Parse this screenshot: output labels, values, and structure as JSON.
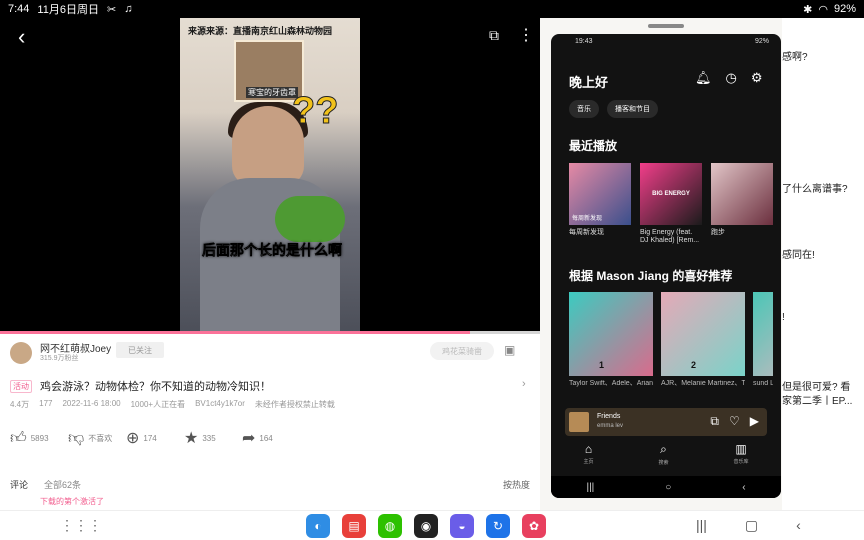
{
  "statusbar": {
    "time": "7:44",
    "date": "11月6日周日",
    "battery": "92%"
  },
  "video": {
    "top_caption": "来源来源：直播南京红山森林动物园",
    "inset_label": "寒宝的牙齿罩",
    "subtitle": "后面那个长的是什么啊",
    "progress": 0.87
  },
  "uploader": {
    "name": "网不红萌叔Joey",
    "fans": "315.9万粉丝",
    "followed": "已关注"
  },
  "search_placeholder": "鸡花菜骑凿",
  "video_info": {
    "tag": "活动",
    "title": "鸡会游泳？动物体检？你不知道的动物冷知识！",
    "views": "4.4万",
    "danmaku": "177",
    "published": "2022-11-6 18:00",
    "watching": "1000+人正在看",
    "bvid": "BV1ct4y1k7or",
    "notice": "未经作者授权禁止转载"
  },
  "actions": [
    {
      "icon": "thumb-up-icon",
      "label": "5893"
    },
    {
      "icon": "thumb-down-icon",
      "label": "不喜欢"
    },
    {
      "icon": "coin-icon",
      "label": "174"
    },
    {
      "icon": "star-icon",
      "label": "335"
    },
    {
      "icon": "share-icon",
      "label": "164"
    }
  ],
  "comments": {
    "label": "评论",
    "count": "全部62条",
    "sort": "按热度"
  },
  "comment_peek": "下载的第个激活了",
  "bg_text": [
    "感啊?",
    "了什么离谱事?",
    "感同在!",
    "!",
    "但是很可爱? 看",
    "家第二季丨EP..."
  ],
  "phone": {
    "status_time": "19:43",
    "battery": "92%",
    "greeting": "晚上好",
    "chips": [
      "音乐",
      "播客和节目"
    ],
    "recent_title": "最近播放",
    "recent": [
      {
        "caption": "每周新发现",
        "art_text": "每周新发现",
        "color1": "#e68aa5",
        "color2": "#3a4f8c"
      },
      {
        "caption": "Big Energy (feat. DJ Khaled) [Rem...",
        "art_text": "BIG ENERGY",
        "color1": "#f23e8a",
        "color2": "#1b1b1b"
      },
      {
        "caption": "跑步",
        "art_text": "",
        "color1": "#e2c6c8",
        "color2": "#6b2f3e"
      }
    ],
    "recs_title": "根据 Mason Jiang 的喜好推荐",
    "recs": [
      {
        "num": "1",
        "caption": "Taylor Swift、Adele、Ariana Grande 等更多曲目",
        "color1": "#3ccbc0",
        "color2": "#d96b8c"
      },
      {
        "num": "2",
        "caption": "AJR、Melanie Martinez、The Score 等更多曲目",
        "color1": "#e5a9b7",
        "color2": "#7ad3c9"
      },
      {
        "num": "",
        "caption": "sund Lund",
        "color1": "#4bc6b6",
        "color2": "#e5b6c2"
      }
    ],
    "now_playing": {
      "title": "Friends",
      "artist": "emma lev"
    },
    "nav": [
      "主页",
      "搜索",
      "音乐库"
    ]
  },
  "dock": [
    {
      "name": "browser-app",
      "color": "#2f8de4",
      "glyph": "◐"
    },
    {
      "name": "notes-app",
      "color": "#e8403a",
      "glyph": "▤"
    },
    {
      "name": "wechat-app",
      "color": "#2dc100",
      "glyph": "◍"
    },
    {
      "name": "qq-app",
      "color": "#222222",
      "glyph": "◉"
    },
    {
      "name": "internet-app",
      "color": "#6a5de8",
      "glyph": "◒"
    },
    {
      "name": "link-app",
      "color": "#1e73e8",
      "glyph": "↻"
    },
    {
      "name": "flower-app",
      "color": "#e8405f",
      "glyph": "✿"
    }
  ]
}
